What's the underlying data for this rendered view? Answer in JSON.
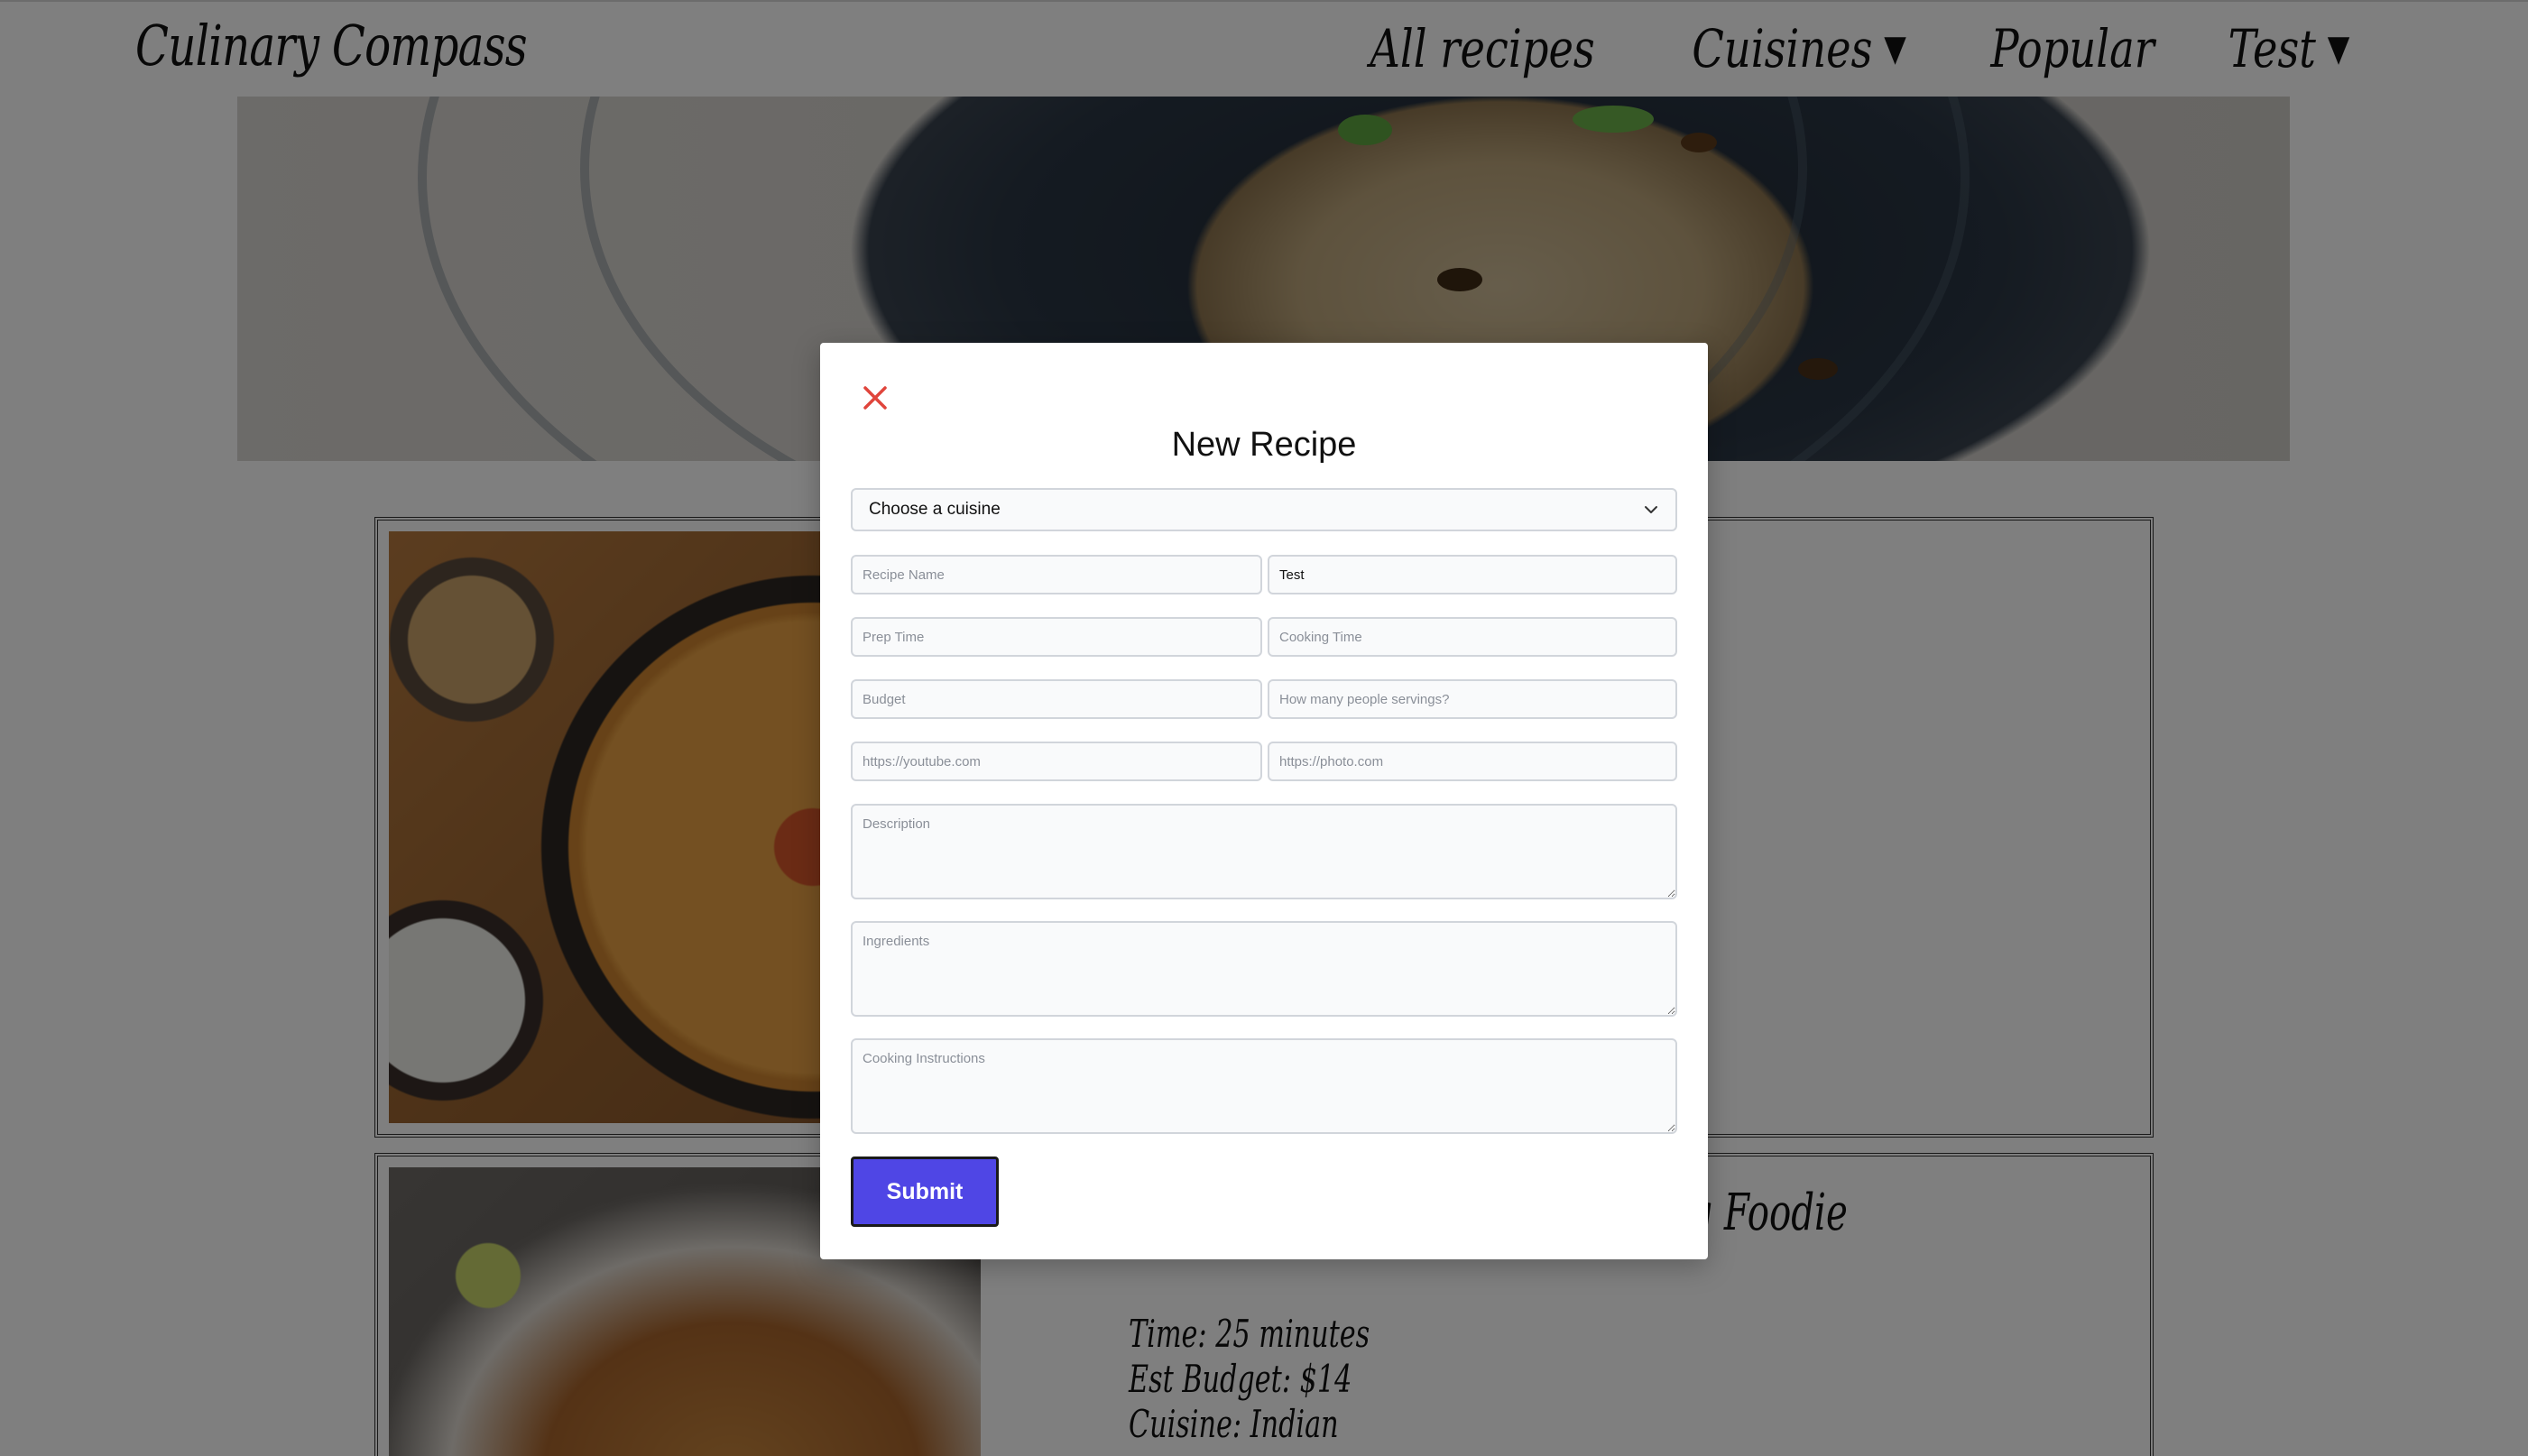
{
  "navbar": {
    "brand": "Culinary Compass",
    "links": [
      {
        "label": "All recipes",
        "has_caret": false
      },
      {
        "label": "Cuisines",
        "has_caret": true
      },
      {
        "label": "Popular",
        "has_caret": false
      },
      {
        "label": "Test",
        "has_caret": true
      }
    ],
    "caret_glyph": "▼"
  },
  "cards": {
    "second": {
      "title_fragment": "king Foodie",
      "time": "Time: 25 minutes",
      "budget": "Est Budget: $14",
      "cuisine": "Cuisine: Indian"
    }
  },
  "modal": {
    "title": "New Recipe",
    "close_icon": "close-icon",
    "cuisine_select": {
      "selected": "Choose a cuisine"
    },
    "fields": {
      "recipe_name": {
        "placeholder": "Recipe Name",
        "value": ""
      },
      "recipe_author": {
        "placeholder": "",
        "value": "Test"
      },
      "prep_time": {
        "placeholder": "Prep Time",
        "value": ""
      },
      "cooking_time": {
        "placeholder": "Cooking Time",
        "value": ""
      },
      "budget": {
        "placeholder": "Budget",
        "value": ""
      },
      "servings": {
        "placeholder": "How many people servings?",
        "value": ""
      },
      "youtube_url": {
        "placeholder": "https://youtube.com",
        "value": ""
      },
      "photo_url": {
        "placeholder": "https://photo.com",
        "value": ""
      },
      "description": {
        "placeholder": "Description"
      },
      "ingredients": {
        "placeholder": "Ingredients"
      },
      "instructions": {
        "placeholder": "Cooking Instructions"
      }
    },
    "submit_label": "Submit"
  },
  "colors": {
    "accent": "#4f46e5",
    "close_icon": "#e0453c",
    "backdrop": "rgba(0,0,0,0.5)"
  }
}
